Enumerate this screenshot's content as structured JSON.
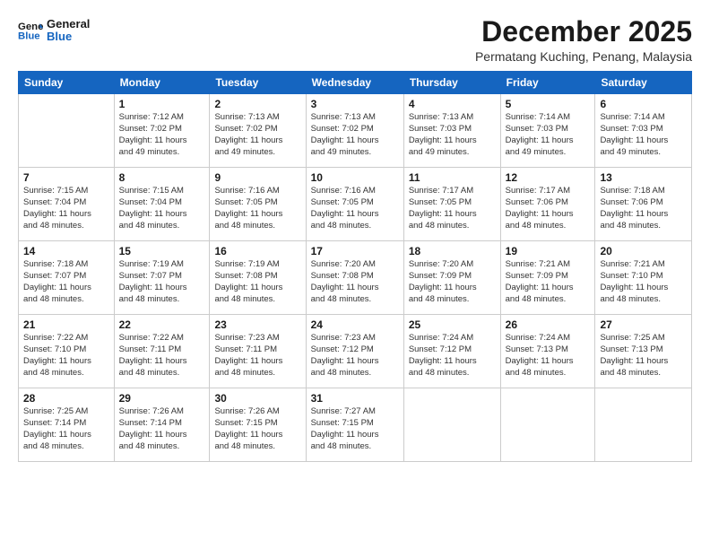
{
  "logo": {
    "line1": "General",
    "line2": "Blue"
  },
  "title": "December 2025",
  "location": "Permatang Kuching, Penang, Malaysia",
  "headers": [
    "Sunday",
    "Monday",
    "Tuesday",
    "Wednesday",
    "Thursday",
    "Friday",
    "Saturday"
  ],
  "weeks": [
    [
      {
        "day": "",
        "info": ""
      },
      {
        "day": "1",
        "info": "Sunrise: 7:12 AM\nSunset: 7:02 PM\nDaylight: 11 hours\nand 49 minutes."
      },
      {
        "day": "2",
        "info": "Sunrise: 7:13 AM\nSunset: 7:02 PM\nDaylight: 11 hours\nand 49 minutes."
      },
      {
        "day": "3",
        "info": "Sunrise: 7:13 AM\nSunset: 7:02 PM\nDaylight: 11 hours\nand 49 minutes."
      },
      {
        "day": "4",
        "info": "Sunrise: 7:13 AM\nSunset: 7:03 PM\nDaylight: 11 hours\nand 49 minutes."
      },
      {
        "day": "5",
        "info": "Sunrise: 7:14 AM\nSunset: 7:03 PM\nDaylight: 11 hours\nand 49 minutes."
      },
      {
        "day": "6",
        "info": "Sunrise: 7:14 AM\nSunset: 7:03 PM\nDaylight: 11 hours\nand 49 minutes."
      }
    ],
    [
      {
        "day": "7",
        "info": "Sunrise: 7:15 AM\nSunset: 7:04 PM\nDaylight: 11 hours\nand 48 minutes."
      },
      {
        "day": "8",
        "info": "Sunrise: 7:15 AM\nSunset: 7:04 PM\nDaylight: 11 hours\nand 48 minutes."
      },
      {
        "day": "9",
        "info": "Sunrise: 7:16 AM\nSunset: 7:05 PM\nDaylight: 11 hours\nand 48 minutes."
      },
      {
        "day": "10",
        "info": "Sunrise: 7:16 AM\nSunset: 7:05 PM\nDaylight: 11 hours\nand 48 minutes."
      },
      {
        "day": "11",
        "info": "Sunrise: 7:17 AM\nSunset: 7:05 PM\nDaylight: 11 hours\nand 48 minutes."
      },
      {
        "day": "12",
        "info": "Sunrise: 7:17 AM\nSunset: 7:06 PM\nDaylight: 11 hours\nand 48 minutes."
      },
      {
        "day": "13",
        "info": "Sunrise: 7:18 AM\nSunset: 7:06 PM\nDaylight: 11 hours\nand 48 minutes."
      }
    ],
    [
      {
        "day": "14",
        "info": "Sunrise: 7:18 AM\nSunset: 7:07 PM\nDaylight: 11 hours\nand 48 minutes."
      },
      {
        "day": "15",
        "info": "Sunrise: 7:19 AM\nSunset: 7:07 PM\nDaylight: 11 hours\nand 48 minutes."
      },
      {
        "day": "16",
        "info": "Sunrise: 7:19 AM\nSunset: 7:08 PM\nDaylight: 11 hours\nand 48 minutes."
      },
      {
        "day": "17",
        "info": "Sunrise: 7:20 AM\nSunset: 7:08 PM\nDaylight: 11 hours\nand 48 minutes."
      },
      {
        "day": "18",
        "info": "Sunrise: 7:20 AM\nSunset: 7:09 PM\nDaylight: 11 hours\nand 48 minutes."
      },
      {
        "day": "19",
        "info": "Sunrise: 7:21 AM\nSunset: 7:09 PM\nDaylight: 11 hours\nand 48 minutes."
      },
      {
        "day": "20",
        "info": "Sunrise: 7:21 AM\nSunset: 7:10 PM\nDaylight: 11 hours\nand 48 minutes."
      }
    ],
    [
      {
        "day": "21",
        "info": "Sunrise: 7:22 AM\nSunset: 7:10 PM\nDaylight: 11 hours\nand 48 minutes."
      },
      {
        "day": "22",
        "info": "Sunrise: 7:22 AM\nSunset: 7:11 PM\nDaylight: 11 hours\nand 48 minutes."
      },
      {
        "day": "23",
        "info": "Sunrise: 7:23 AM\nSunset: 7:11 PM\nDaylight: 11 hours\nand 48 minutes."
      },
      {
        "day": "24",
        "info": "Sunrise: 7:23 AM\nSunset: 7:12 PM\nDaylight: 11 hours\nand 48 minutes."
      },
      {
        "day": "25",
        "info": "Sunrise: 7:24 AM\nSunset: 7:12 PM\nDaylight: 11 hours\nand 48 minutes."
      },
      {
        "day": "26",
        "info": "Sunrise: 7:24 AM\nSunset: 7:13 PM\nDaylight: 11 hours\nand 48 minutes."
      },
      {
        "day": "27",
        "info": "Sunrise: 7:25 AM\nSunset: 7:13 PM\nDaylight: 11 hours\nand 48 minutes."
      }
    ],
    [
      {
        "day": "28",
        "info": "Sunrise: 7:25 AM\nSunset: 7:14 PM\nDaylight: 11 hours\nand 48 minutes."
      },
      {
        "day": "29",
        "info": "Sunrise: 7:26 AM\nSunset: 7:14 PM\nDaylight: 11 hours\nand 48 minutes."
      },
      {
        "day": "30",
        "info": "Sunrise: 7:26 AM\nSunset: 7:15 PM\nDaylight: 11 hours\nand 48 minutes."
      },
      {
        "day": "31",
        "info": "Sunrise: 7:27 AM\nSunset: 7:15 PM\nDaylight: 11 hours\nand 48 minutes."
      },
      {
        "day": "",
        "info": ""
      },
      {
        "day": "",
        "info": ""
      },
      {
        "day": "",
        "info": ""
      }
    ]
  ]
}
